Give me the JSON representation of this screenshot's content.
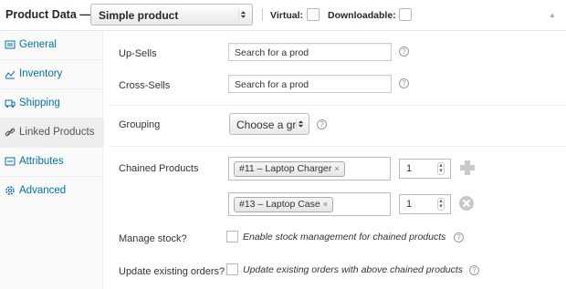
{
  "header": {
    "title": "Product Data —",
    "product_type": "Simple product",
    "virtual_label": "Virtual:",
    "downloadable_label": "Downloadable:"
  },
  "sidebar": {
    "items": [
      {
        "label": "General",
        "icon": "general-icon"
      },
      {
        "label": "Inventory",
        "icon": "inventory-icon"
      },
      {
        "label": "Shipping",
        "icon": "shipping-icon"
      },
      {
        "label": "Linked Products",
        "icon": "link-icon",
        "active": true
      },
      {
        "label": "Attributes",
        "icon": "attributes-icon"
      },
      {
        "label": "Advanced",
        "icon": "gear-icon"
      }
    ]
  },
  "fields": {
    "upsells_label": "Up-Sells",
    "upsells_placeholder": "Search for a prod",
    "crosssells_label": "Cross-Sells",
    "crosssells_placeholder": "Search for a prod",
    "grouping_label": "Grouping",
    "grouping_value": "Choose a gr",
    "chained_label": "Chained Products",
    "chained": [
      {
        "product": "#11 – Laptop Charger",
        "qty": "1"
      },
      {
        "product": "#13 – Laptop Case",
        "qty": "1"
      }
    ],
    "manage_stock_label": "Manage stock?",
    "manage_stock_text": "Enable stock management for chained products",
    "update_orders_label": "Update existing orders?",
    "update_orders_text": "Update existing orders with above chained products"
  },
  "help_glyph": "?",
  "remove_glyph": "×"
}
